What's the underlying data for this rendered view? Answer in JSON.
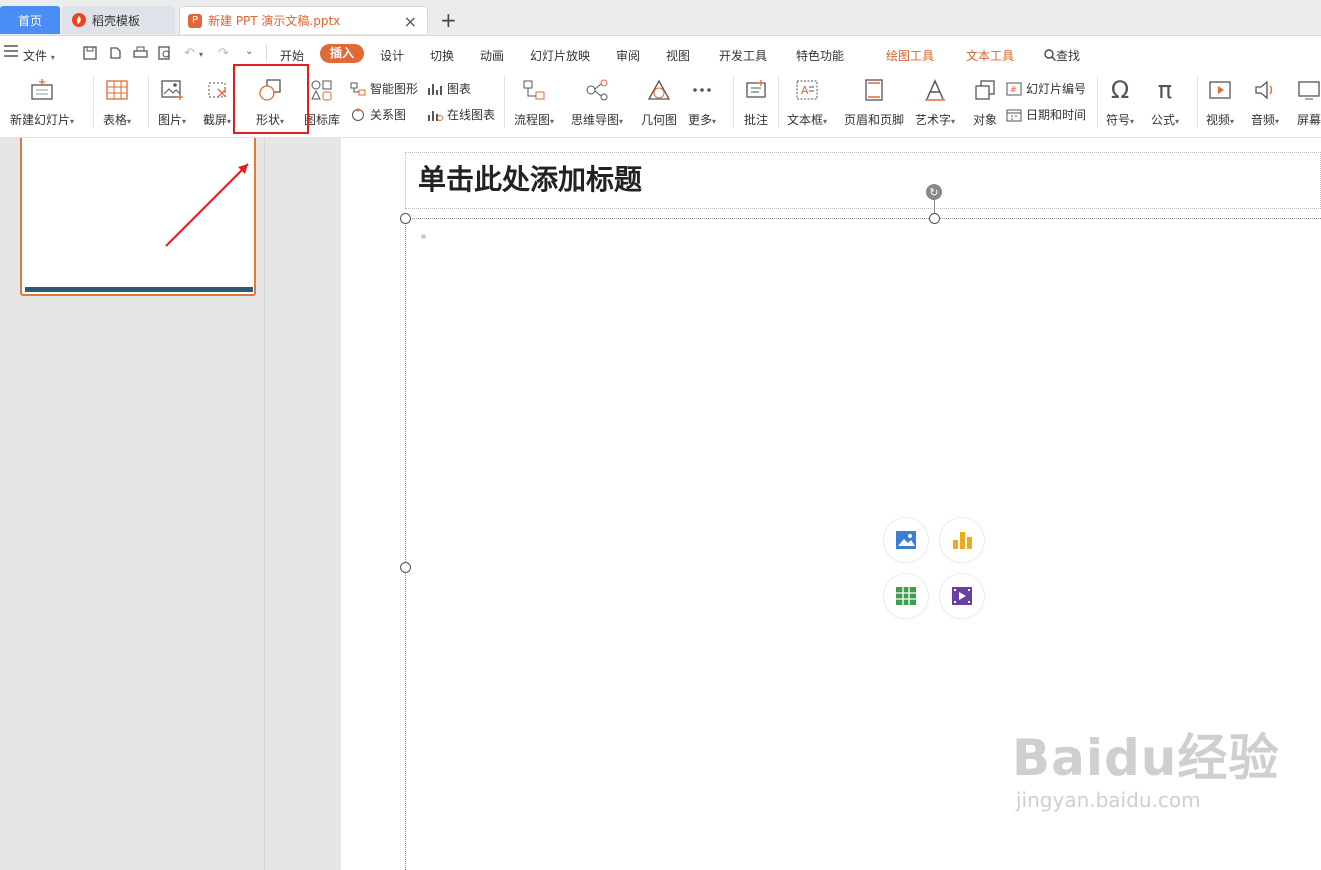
{
  "tabs": {
    "home": "首页",
    "docer": "稻壳模板",
    "document": "新建 PPT 演示文稿.pptx",
    "close": "×",
    "new_tab": "+"
  },
  "menu": {
    "file": "文件",
    "items": [
      "开始",
      "插入",
      "设计",
      "切换",
      "动画",
      "幻灯片放映",
      "审阅",
      "视图",
      "开发工具",
      "特色功能"
    ],
    "context_items": [
      "绘图工具",
      "文本工具"
    ],
    "search": "查找",
    "active": "插入"
  },
  "ribbon": {
    "new_slide": "新建幻灯片",
    "table": "表格",
    "picture": "图片",
    "screenshot": "截屏",
    "shape": "形状",
    "icon_library": "图标库",
    "smart_art": "智能图形",
    "chart": "图表",
    "relation": "关系图",
    "online_chart": "在线图表",
    "flowchart": "流程图",
    "mindmap": "思维导图",
    "geometry": "几何图",
    "more": "更多",
    "comment": "批注",
    "textbox": "文本框",
    "header_footer": "页眉和页脚",
    "wordart": "艺术字",
    "object": "对象",
    "slide_number": "幻灯片编号",
    "date_time": "日期和时间",
    "symbol": "符号",
    "formula": "公式",
    "video": "视频",
    "audio": "音频",
    "screen": "屏幕"
  },
  "slide": {
    "title_placeholder": "单击此处添加标题"
  },
  "watermark": {
    "brand": "Baidu经验",
    "url": "jingyan.baidu.com"
  },
  "colors": {
    "accent": "#e06a35",
    "highlight": "#e02020",
    "home_tab": "#4a8ef5"
  },
  "icons": [
    "image-icon",
    "chart-bar-icon",
    "table-icon",
    "video-icon"
  ]
}
